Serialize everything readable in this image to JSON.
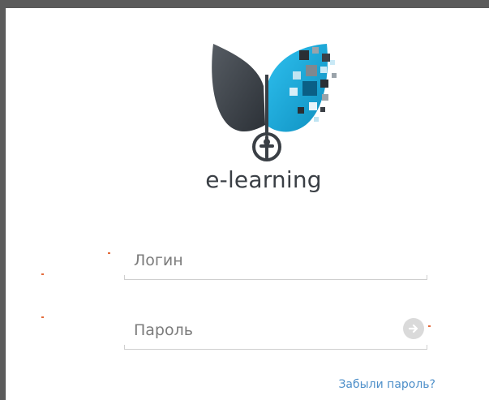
{
  "brand": {
    "name": "e-learning"
  },
  "login_form": {
    "login_placeholder": "Логин",
    "password_placeholder": "Пароль",
    "forgot_password_link": "Забыли пароль?"
  },
  "icons": {
    "submit": "arrow-right-circle-icon",
    "logo": "book-leaf-logo"
  },
  "colors": {
    "frame_border": "#5b5b5b",
    "brand_dark": "#3a3f45",
    "brand_blue": "#1fa2d6",
    "link": "#4d8fc9",
    "field_underline": "#cfcfcf"
  }
}
